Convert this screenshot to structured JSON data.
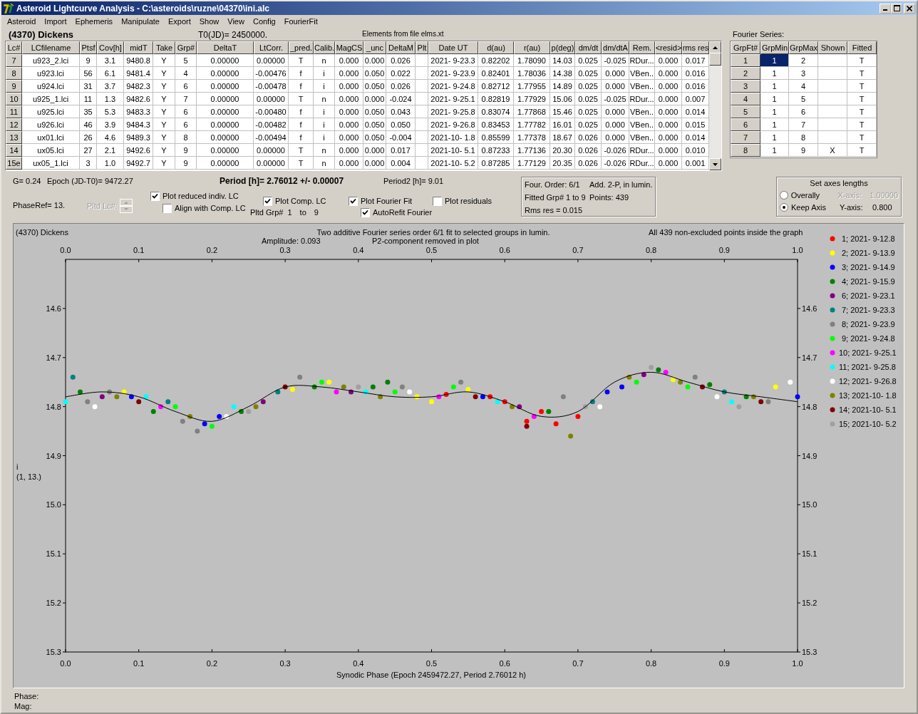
{
  "window": {
    "title": "Asteroid Lightcurve Analysis - C:\\asteroids\\ruzne\\04370\\ini.alc"
  },
  "menu": [
    "Asteroid",
    "Import",
    "Ephemeris",
    "Manipulate",
    "Export",
    "Show",
    "View",
    "Config",
    "FourierFit"
  ],
  "header": {
    "object": "(4370) Dickens",
    "t0": "T0(JD)= 2450000.",
    "elements": "Elements from file elms.xt",
    "fourier_label": "Fourier Series:"
  },
  "lc_table": {
    "columns": [
      "Lc#",
      "LCfilename",
      "Ptsf",
      "Cov[h]",
      "midT",
      "Take",
      "Grp#",
      "DeltaT",
      "LtCorr.",
      "_pred.",
      "Calib.",
      "MagCS",
      "_unc",
      "DeltaM",
      "Plt",
      "Date UT",
      "d(au)",
      "r(au)",
      "p(deg)",
      "dm/dt",
      "dm/dtA",
      "Rem.",
      "<resid>",
      "rms res"
    ],
    "rows": [
      [
        "7",
        "u923_2.lci",
        "9",
        "3.1",
        "9480.8",
        "Y",
        "5",
        "0.00000",
        "0.00000",
        "T",
        "n",
        "0.000",
        "0.000",
        "0.026",
        null,
        "2021- 9-23.3",
        "0.82202",
        "1.78090",
        "14.03",
        "0.025",
        "-0.025",
        "RDur...",
        "0.000",
        "0.017"
      ],
      [
        "8",
        "u923.lci",
        "56",
        "6.1",
        "9481.4",
        "Y",
        "4",
        "0.00000",
        "-0.00476",
        "f",
        "i",
        "0.000",
        "0.050",
        "0.022",
        null,
        "2021- 9-23.9",
        "0.82401",
        "1.78036",
        "14.38",
        "0.025",
        "0.000",
        "VBen..",
        "0.000",
        "0.016"
      ],
      [
        "9",
        "u924.lci",
        "31",
        "3.7",
        "9482.3",
        "Y",
        "6",
        "0.00000",
        "-0.00478",
        "f",
        "i",
        "0.000",
        "0.050",
        "0.026",
        null,
        "2021- 9-24.8",
        "0.82712",
        "1.77955",
        "14.89",
        "0.025",
        "0.000",
        "VBen..",
        "0.000",
        "0.016"
      ],
      [
        "10",
        "u925_1.lci",
        "11",
        "1.3",
        "9482.6",
        "Y",
        "7",
        "0.00000",
        "0.00000",
        "T",
        "n",
        "0.000",
        "0.000",
        "-0.024",
        null,
        "2021- 9-25.1",
        "0.82819",
        "1.77929",
        "15.06",
        "0.025",
        "-0.025",
        "RDur...",
        "0.000",
        "0.007"
      ],
      [
        "11",
        "u925.lci",
        "35",
        "5.3",
        "9483.3",
        "Y",
        "6",
        "0.00000",
        "-0.00480",
        "f",
        "i",
        "0.000",
        "0.050",
        "0.043",
        null,
        "2021- 9-25.8",
        "0.83074",
        "1.77868",
        "15.46",
        "0.025",
        "0.000",
        "VBen..",
        "0.000",
        "0.014"
      ],
      [
        "12",
        "u926.lci",
        "46",
        "3.9",
        "9484.3",
        "Y",
        "6",
        "0.00000",
        "-0.00482",
        "f",
        "i",
        "0.000",
        "0.050",
        "0.050",
        null,
        "2021- 9-26.8",
        "0.83453",
        "1.77782",
        "16.01",
        "0.025",
        "0.000",
        "VBen..",
        "0.000",
        "0.015"
      ],
      [
        "13",
        "ux01.lci",
        "26",
        "4.6",
        "9489.3",
        "Y",
        "8",
        "0.00000",
        "-0.00494",
        "f",
        "i",
        "0.000",
        "0.050",
        "-0.004",
        null,
        "2021-10- 1.8",
        "0.85599",
        "1.77378",
        "18.67",
        "0.026",
        "0.000",
        "VBen..",
        "0.000",
        "0.014"
      ],
      [
        "14",
        "ux05.lci",
        "27",
        "2.1",
        "9492.6",
        "Y",
        "9",
        "0.00000",
        "0.00000",
        "T",
        "n",
        "0.000",
        "0.000",
        "0.017",
        null,
        "2021-10- 5.1",
        "0.87233",
        "1.77136",
        "20.30",
        "0.026",
        "-0.026",
        "RDur...",
        "0.000",
        "0.010"
      ],
      [
        "15e",
        "ux05_1.lci",
        "3",
        "1.0",
        "9492.7",
        "Y",
        "9",
        "0.00000",
        "0.00000",
        "T",
        "n",
        "0.000",
        "0.000",
        "0.004",
        null,
        "2021-10- 5.2",
        "0.87285",
        "1.77129",
        "20.35",
        "0.026",
        "-0.026",
        "RDur...",
        "0.000",
        "0.001"
      ]
    ]
  },
  "fourier_table": {
    "columns": [
      "GrpFt#",
      "GrpMin",
      "GrpMax",
      "Shown",
      "Fitted"
    ],
    "rows": [
      {
        "grp_ft": "1",
        "grp_min": "1",
        "grp_max": "2",
        "fitted": "T",
        "selected": true
      },
      {
        "grp_ft": "2",
        "grp_min": "1",
        "grp_max": "3",
        "fitted": "T",
        "selected": false
      },
      {
        "grp_ft": "3",
        "grp_min": "1",
        "grp_max": "4",
        "fitted": "T",
        "selected": false
      },
      {
        "grp_ft": "4",
        "grp_min": "1",
        "grp_max": "5",
        "fitted": "T",
        "selected": false
      },
      {
        "grp_ft": "5",
        "grp_min": "1",
        "grp_max": "6",
        "fitted": "T",
        "selected": false
      },
      {
        "grp_ft": "6",
        "grp_min": "1",
        "grp_max": "7",
        "fitted": "T",
        "selected": false
      },
      {
        "grp_ft": "7",
        "grp_min": "1",
        "grp_max": "8",
        "fitted": "T",
        "selected": false
      },
      {
        "grp_ft": "8",
        "grp_min": "1",
        "grp_max": "9",
        "shown": "X",
        "fitted": "T",
        "selected": false
      }
    ]
  },
  "controls": {
    "g": "G= 0.24",
    "epoch": "Epoch (JD-T0)= 9472.27",
    "period": "Period [h]= 2.76012 +/- 0.00007",
    "period2": "Period2 [h]= 9.01",
    "phase_ref": "PhaseRef= 13.",
    "pltd_lc": {
      "label": "Pltd Lc#:",
      "disabled": true
    },
    "checkboxes": [
      {
        "label": "Plot reduced indiv. LC",
        "checked": true
      },
      {
        "label": "Align with Comp. LC",
        "checked": false
      },
      {
        "label": "Plot Comp. LC",
        "checked": true
      },
      {
        "label": "Plot Fourier Fit",
        "checked": true
      },
      {
        "label": "AutoRefit Fourier",
        "checked": true
      },
      {
        "label": "Plot residuals",
        "checked": false
      }
    ],
    "pltd_grp": {
      "label": "Pltd Grp#",
      "from": "1",
      "to_label": "to",
      "to": "9"
    }
  },
  "fit_info": [
    "Four. Order:  6/1",
    "Add. 2-P, in lumin.",
    "Fitted Grp# 1 to 9",
    "Points: 439",
    "Rms res     = 0.015"
  ],
  "axes_box": {
    "title": "Set axes lengths",
    "options": [
      {
        "label": "Overally",
        "selected": false
      },
      {
        "label": "Keep Axis",
        "selected": true
      }
    ],
    "x_axis": {
      "label": "X-axis:",
      "value": "1.00000",
      "disabled": true
    },
    "y_axis": {
      "label": "Y-axis:",
      "value": "0.800",
      "disabled": false
    }
  },
  "plot": {
    "object": "(4370) Dickens",
    "subtitle_left": "Amplitude: 0.093",
    "subtitle_right": "P2-component removed in plot",
    "note": "All 439 non-excluded points inside the graph",
    "ylabel_line2": "(1, 13.)",
    "chart_data": {
      "type": "scatter",
      "title": "Two additive Fourier series order 6/1 fit to selected groups in lumin.",
      "xlabel": "Synodic Phase (Epoch 2459472.27, Period 2.76012 h)",
      "ylabel": "i",
      "legend": "right",
      "xlim": [
        0,
        1
      ],
      "ylim": [
        15.3,
        14.5
      ],
      "xticks": [
        {
          "value": 0,
          "label": "0.0"
        },
        {
          "value": 0.1,
          "label": "0.1"
        },
        {
          "value": 0.2,
          "label": "0.2"
        },
        {
          "value": 0.3,
          "label": "0.3"
        },
        {
          "value": 0.4,
          "label": "0.4"
        },
        {
          "value": 0.5,
          "label": "0.5"
        },
        {
          "value": 0.6,
          "label": "0.6"
        },
        {
          "value": 0.7,
          "label": "0.7"
        },
        {
          "value": 0.8,
          "label": "0.8"
        },
        {
          "value": 0.9,
          "label": "0.9"
        },
        {
          "value": 1,
          "label": "1.0"
        }
      ],
      "yticks": [
        14.6,
        14.7,
        14.8,
        14.9,
        {
          "value": 15,
          "label": "15.0"
        },
        15.1,
        15.2,
        15.3
      ],
      "series": [
        {
          "name": "1; 2021- 9-12.8",
          "color": "#ff0000",
          "x": [
            0.52,
            0.58,
            0.6,
            0.63,
            0.65,
            0.67,
            0.7
          ],
          "values": [
            14.775,
            14.78,
            14.79,
            14.83,
            14.81,
            14.835,
            14.82
          ]
        },
        {
          "name": "2; 2021- 9-13.9",
          "color": "#ffff00",
          "x": [
            0.08,
            0.31,
            0.36,
            0.48,
            0.5,
            0.55,
            0.83,
            0.97
          ],
          "values": [
            14.77,
            14.765,
            14.75,
            14.78,
            14.79,
            14.765,
            14.745,
            14.76
          ]
        },
        {
          "name": "3; 2021- 9-14.9",
          "color": "#0000ff",
          "x": [
            0.09,
            0.19,
            0.21,
            0.57,
            0.74,
            0.76,
            1.0
          ],
          "values": [
            14.78,
            14.835,
            14.82,
            14.78,
            14.77,
            14.76,
            14.78
          ]
        },
        {
          "name": "4; 2021- 9-15.9",
          "color": "#008000",
          "x": [
            0.02,
            0.12,
            0.24,
            0.34,
            0.42,
            0.44,
            0.66,
            0.81,
            0.88,
            0.93
          ],
          "values": [
            14.77,
            14.81,
            14.81,
            14.76,
            14.76,
            14.75,
            14.81,
            14.725,
            14.755,
            14.78
          ]
        },
        {
          "name": "6; 2021- 9-23.1",
          "color": "#800080",
          "x": [
            0.05,
            0.27,
            0.39,
            0.62,
            0.79
          ],
          "values": [
            14.78,
            14.79,
            14.77,
            14.8,
            14.735
          ]
        },
        {
          "name": "7; 2021- 9-23.3",
          "color": "#008080",
          "x": [
            0.01,
            0.14,
            0.29,
            0.72,
            0.9
          ],
          "values": [
            14.74,
            14.79,
            14.77,
            14.79,
            14.77
          ]
        },
        {
          "name": "8; 2021- 9-23.9",
          "color": "#808080",
          "x": [
            0.03,
            0.06,
            0.16,
            0.18,
            0.32,
            0.46,
            0.54,
            0.68,
            0.86,
            0.96
          ],
          "values": [
            14.79,
            14.77,
            14.83,
            14.85,
            14.74,
            14.76,
            14.75,
            14.78,
            14.74,
            14.79
          ]
        },
        {
          "name": "9; 2021- 9-24.8",
          "color": "#00ff00",
          "x": [
            0.15,
            0.2,
            0.35,
            0.45,
            0.53,
            0.78,
            0.85
          ],
          "values": [
            14.8,
            14.84,
            14.75,
            14.77,
            14.76,
            14.75,
            14.76
          ]
        },
        {
          "name": "10; 2021- 9-25.1",
          "color": "#ff00ff",
          "x": [
            0.13,
            0.37,
            0.51,
            0.64,
            0.82
          ],
          "values": [
            14.8,
            14.77,
            14.78,
            14.82,
            14.73
          ]
        },
        {
          "name": "11; 2021- 9-25.8",
          "color": "#00ffff",
          "x": [
            0.0,
            0.11,
            0.23,
            0.41,
            0.59,
            0.91
          ],
          "values": [
            14.79,
            14.78,
            14.8,
            14.77,
            14.79,
            14.79
          ]
        },
        {
          "name": "12; 2021- 9-26.8",
          "color": "#ffffff",
          "x": [
            0.04,
            0.22,
            0.47,
            0.73,
            0.89,
            0.99
          ],
          "values": [
            14.8,
            14.82,
            14.77,
            14.8,
            14.78,
            14.75
          ]
        },
        {
          "name": "13; 2021-10- 1.8",
          "color": "#808000",
          "x": [
            0.07,
            0.17,
            0.26,
            0.38,
            0.43,
            0.61,
            0.69,
            0.77,
            0.84,
            0.94
          ],
          "values": [
            14.78,
            14.82,
            14.8,
            14.76,
            14.78,
            14.8,
            14.86,
            14.74,
            14.75,
            14.78
          ]
        },
        {
          "name": "14; 2021-10- 5.1",
          "color": "#800000",
          "x": [
            0.1,
            0.3,
            0.56,
            0.63,
            0.87,
            0.95
          ],
          "values": [
            14.79,
            14.76,
            14.78,
            14.84,
            14.76,
            14.79
          ]
        },
        {
          "name": "15; 2021-10- 5.2",
          "color": "#a0a0a0",
          "x": [
            0.25,
            0.4,
            0.71,
            0.8,
            0.92
          ],
          "values": [
            14.81,
            14.76,
            14.8,
            14.72,
            14.8
          ]
        },
        {
          "type": "line",
          "color": "#000000",
          "x": [
            0,
            0.05,
            0.1,
            0.15,
            0.2,
            0.25,
            0.3,
            0.35,
            0.4,
            0.45,
            0.5,
            0.55,
            0.6,
            0.65,
            0.7,
            0.75,
            0.8,
            0.85,
            0.9,
            0.95,
            1
          ],
          "values": [
            14.78,
            14.77,
            14.78,
            14.81,
            14.83,
            14.8,
            14.76,
            14.76,
            14.77,
            14.78,
            14.78,
            14.77,
            14.79,
            14.82,
            14.81,
            14.75,
            14.73,
            14.75,
            14.77,
            14.78,
            14.79
          ]
        }
      ]
    },
    "right_axis_labels": [
      "14.6",
      "14.7",
      "14.8",
      "14.9",
      "15.0",
      "15.1",
      "15.2",
      "15.3"
    ]
  },
  "status": {
    "phase": "Phase:",
    "mag": "Mag:"
  }
}
